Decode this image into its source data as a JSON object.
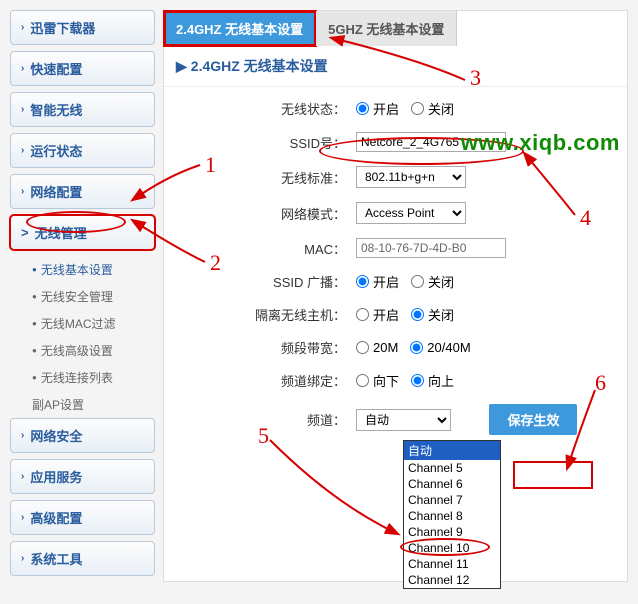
{
  "watermark": "www.xiqb.com",
  "sidebar": {
    "items": [
      "迅雷下载器",
      "快速配置",
      "智能无线",
      "运行状态",
      "网络配置",
      "无线管理",
      "网络安全",
      "应用服务",
      "高级配置",
      "系统工具"
    ],
    "active_index": 5,
    "active_label_prefix": ">",
    "subitems": [
      "无线基本设置",
      "无线安全管理",
      "无线MAC过滤",
      "无线高级设置",
      "无线连接列表",
      "副AP设置"
    ],
    "sub_active_index": 0
  },
  "tabs": {
    "items": [
      "2.4GHZ 无线基本设置",
      "5GHZ 无线基本设置"
    ],
    "active_index": 0
  },
  "section_title": "2.4GHZ 无线基本设置",
  "form": {
    "wireless_status": {
      "label": "无线状态：",
      "on": "开启",
      "off": "关闭",
      "value": "on"
    },
    "ssid": {
      "label": "SSID号：",
      "value": "Netcore_2_4G765"
    },
    "standard": {
      "label": "无线标准：",
      "value": "802.11b+g+n"
    },
    "mode": {
      "label": "网络模式：",
      "value": "Access Point"
    },
    "mac": {
      "label": "MAC：",
      "value": "08-10-76-7D-4D-B0"
    },
    "ssid_broadcast": {
      "label": "SSID 广播：",
      "on": "开启",
      "off": "关闭",
      "value": "on"
    },
    "isolation": {
      "label": "隔离无线主机：",
      "on": "开启",
      "off": "关闭",
      "value": "off"
    },
    "bandwidth": {
      "label": "频段带宽：",
      "opt1": "20M",
      "opt2": "20/40M",
      "value": "20/40M"
    },
    "channel_bind": {
      "label": "频道绑定：",
      "opt1": "向下",
      "opt2": "向上",
      "value": "up"
    },
    "channel": {
      "label": "频道：",
      "value": "自动",
      "options": [
        "自动",
        "Channel 5",
        "Channel 6",
        "Channel 7",
        "Channel 8",
        "Channel 9",
        "Channel 10",
        "Channel 11",
        "Channel 12"
      ]
    }
  },
  "save_button": "保存生效",
  "annotations": {
    "n1": "1",
    "n2": "2",
    "n3": "3",
    "n4": "4",
    "n5": "5",
    "n6": "6"
  }
}
